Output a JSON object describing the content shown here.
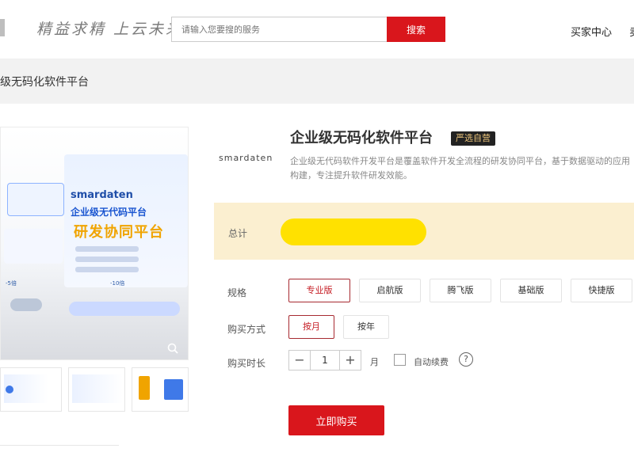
{
  "header": {
    "logo_text": "精益求精 上云未来",
    "search_placeholder": "请输入您要搜的服务",
    "search_button": "搜索",
    "nav": [
      "买家中心",
      "卖"
    ]
  },
  "breadcrumb": {
    "text": "级无码化软件平台"
  },
  "gallery": {
    "hero_brand": "smardaten",
    "hero_sub": "企业级无代码平台",
    "hero_title": "研发协同平台",
    "hero_stat_left": "-5倍",
    "hero_stat_right": "-10倍"
  },
  "product": {
    "brand_logo": "smardaten",
    "title": "企业级无码化软件平台",
    "badge": "严选自营",
    "description": "企业级无代码软件开发平台是覆盖软件开发全流程的研发协同平台，基于数据驱动的应用构建，专注提升软件研发效能。"
  },
  "price": {
    "label": "总计"
  },
  "spec": {
    "label": "规格",
    "options": [
      "专业版",
      "启航版",
      "腾飞版",
      "基础版",
      "快捷版"
    ],
    "selected_index": 0
  },
  "purchase_mode": {
    "label": "购买方式",
    "options": [
      "按月",
      "按年"
    ],
    "selected_index": 0
  },
  "duration": {
    "label": "购买时长",
    "minus": "−",
    "value": "1",
    "plus": "+",
    "unit": "月",
    "auto_renew_label": "自动续费",
    "help": "?"
  },
  "buy_button": "立即购买",
  "colors": {
    "accent_red": "#d9161c",
    "price_band": "#fbefd0",
    "price_highlight": "#ffe100"
  }
}
